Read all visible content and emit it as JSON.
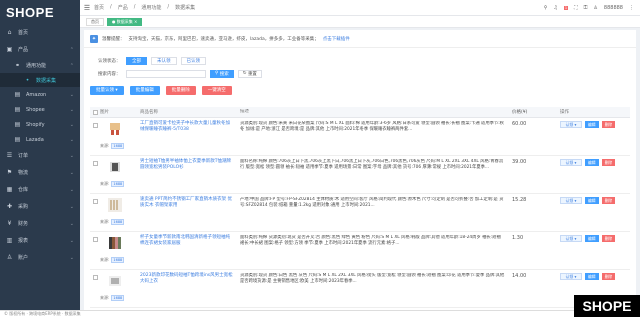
{
  "app": {
    "logo": "SHOPE",
    "corner_logo": "SHOPE"
  },
  "sidebar": {
    "items": [
      {
        "icon": "home-icon",
        "glyph": "⌂",
        "label": "首页"
      },
      {
        "icon": "box-icon",
        "glyph": "▣",
        "label": "产品"
      },
      {
        "icon": "link-icon",
        "glyph": "⚭",
        "label": "通用功能"
      },
      {
        "icon": "dot-icon",
        "glyph": "•",
        "label": "数据采集"
      },
      {
        "icon": "amazon-icon",
        "glyph": "▤",
        "label": "Amazon"
      },
      {
        "icon": "shopee-icon",
        "glyph": "▤",
        "label": "Shopee"
      },
      {
        "icon": "shopify-icon",
        "glyph": "▤",
        "label": "Shopify"
      },
      {
        "icon": "lazada-icon",
        "glyph": "▤",
        "label": "Lazada"
      },
      {
        "icon": "order-icon",
        "glyph": "☰",
        "label": "订单"
      },
      {
        "icon": "logistics-icon",
        "glyph": "⚑",
        "label": "物流"
      },
      {
        "icon": "warehouse-icon",
        "glyph": "▦",
        "label": "仓库"
      },
      {
        "icon": "purchase-icon",
        "glyph": "✚",
        "label": "采购"
      },
      {
        "icon": "finance-icon",
        "glyph": "¥",
        "label": "财务"
      },
      {
        "icon": "report-icon",
        "glyph": "▥",
        "label": "报表"
      },
      {
        "icon": "account-icon",
        "glyph": "♙",
        "label": "账户"
      }
    ]
  },
  "topbar": {
    "breadcrumb": [
      "首页",
      "/",
      "产品",
      "/",
      "通用功能",
      "/",
      "数据采集"
    ],
    "user": "888888",
    "badge": "1"
  },
  "tabs": [
    {
      "label": "首页",
      "active": false
    },
    {
      "label": "● 数据采集 ×",
      "active": true
    }
  ],
  "platforms": {
    "label": "温馨提醒：",
    "text": "支持淘宝，天猫，京东，阿里巴巴，速卖通，亚马逊，虾皮，lazada，拼多多，工业备等采集；",
    "more": "点击下载插件"
  },
  "filters": {
    "status_label": "认领状态：",
    "status_options": [
      "全部",
      "未认领",
      "已认领"
    ],
    "search_label": "搜索内容：",
    "search_placeholder": "",
    "search_btn": "搜索",
    "reset_btn": "重置"
  },
  "actions": [
    "批量认领 ▾",
    "批量编辑",
    "批量删除",
    "一键清空"
  ],
  "table": {
    "headers": [
      "",
      "图片",
      "商品名称",
      "描述",
      "价格(¥)",
      "操作"
    ],
    "rows": [
      {
        "title": "工厂直销可爱卡拉夹子中长款大童儿童秋冬加绒保暖睡衣睡裤-5/T038",
        "desc": "货源类别:现货 颜色:米黄 米白花朵图案 尺码:S M L XL 面料:棉 适用年龄:3-6岁 风格:日系可爱 领型:圆领 袖长:长袖 图案:卡通 适用季节:秋冬 加绒:是 产地:浙江 是否跨境:是 品牌:其他 上市时间:2021年冬季 保暖睡衣睡裤两件套...",
        "price": "60.00",
        "source": "来源:",
        "src_badge": "1688"
      },
      {
        "title": "男士短袖T恤男半袖体恤上衣夏季新款T恤潮牌圆领宽松男装POLO衫",
        "desc": "面料名称:纯棉 颜色:706灰上白下黑,706灰上黑下白,706黑上白下灰,706白色,706黑色,706灰色 尺码:M L XL 2XL 3XL 4XL 风格:青春流行 版型:宽松 领型:圆领 袖长:短袖 适用季节:夏季 适用场景:日常 图案:字母 品牌:其他 货号:706 厚薄:常规 上市时间:2021年夏季...",
        "price": "39.00",
        "source": "来源:",
        "src_badge": "1688"
      },
      {
        "title": "速卖通 PPT简约不锈钢工厂家直销木质衣架 优质实木 衣帽架家用",
        "desc": "产地:中国 品牌:FP 型号:FP-SFZ02814 主体材质:木 适用空间:客厅 风格:简约现代 颜色:原木色 尺寸:可定制 是否可折叠:否 加工定制:是 货号:SFZ02814 包装:纸箱 重量:1.2kg 适用对象:通用 上市时间:2021...",
        "price": "15.28",
        "source": "来源:",
        "src_badge": "1688"
      },
      {
        "title": "杯子女童季节新款南北韩国清新格子领短袖纯棉连衣裙女装家居服",
        "desc": "面料类别:纯棉 货源类别:现货 是否开叉:否 颜色:黑色 绿色 黄色 粉色 尺码:S M L XL 风格:韩版 品牌:其他 适用年龄:18-24周岁 袖长:短袖 裙长:中长裙 图案:格子 领型:方领 季节:夏季 上市时间:2021年夏季 流行元素:格子...",
        "price": "1.30",
        "source": "来源:",
        "src_badge": "1688"
      },
      {
        "title": "2023新款印花数码短袖T恤跨境ins风男士宽松大码上衣",
        "desc": "货源类别:现货 颜色:白色 黑色 灰色 尺码:S M L XL 2XL 3XL 风格:街头 版型:宽松 领型:圆领 袖长:短袖 图案:印花 适用季节:夏季 品牌:其他 是否跨境货源:是 主要销售地区:欧美 上市时间:2023年春季...",
        "price": "14.00",
        "source": "来源:",
        "src_badge": "1688"
      }
    ],
    "op_select": "认领 ▾",
    "op_edit": "编辑",
    "op_delete": "删除"
  },
  "footer": "© 版权所有 · 跨境电商ERP系统 · 数据采集"
}
